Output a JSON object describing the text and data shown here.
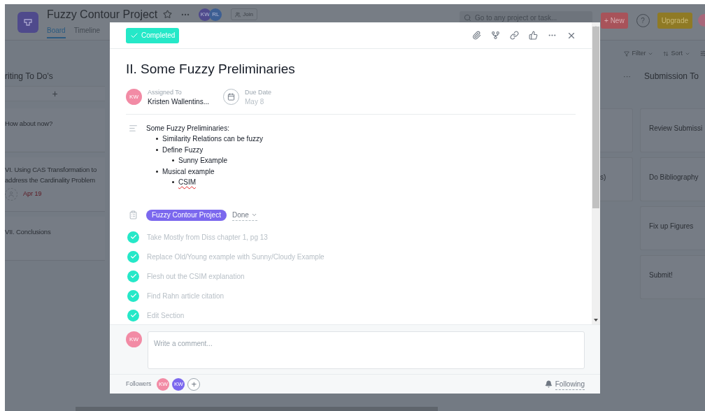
{
  "topbar": {
    "project_title": "Fuzzy Contour Project",
    "members": [
      {
        "initials": "KW",
        "color": "#4f4a8c"
      },
      {
        "initials": "RL",
        "color": "#3d5f93"
      }
    ],
    "join": "Join",
    "tabs": [
      {
        "label": "Board",
        "selected": true
      },
      {
        "label": "Timeline",
        "selected": false
      }
    ],
    "search": {
      "placeholder": "Go to any project or task..."
    },
    "new_button": "+ New",
    "help": "?",
    "upgrade": "Upgrade"
  },
  "toolbar": {
    "filter": "Filter",
    "sort": "Sort"
  },
  "left_column": {
    "title": "riting To Do's",
    "add": "+",
    "cards": [
      {
        "title": "How about now?"
      },
      {
        "title": "VI. Using CAS Transformation to address the Cardinality Problem",
        "due": "Apr 19"
      },
      {
        "title": "VII. Conclusions"
      }
    ]
  },
  "middle_column": {
    "menu": "···",
    "cards": [
      {
        "title": "s)"
      }
    ]
  },
  "right_column": {
    "title": "Submission To",
    "cards": [
      {
        "title": "Review Submissi"
      },
      {
        "title": "Do Bibliography"
      },
      {
        "title": "Fix up Figures"
      },
      {
        "title": "Submit!"
      }
    ]
  },
  "task": {
    "completed": true,
    "completed_label": "Completed",
    "title": "II. Some Fuzzy Preliminaries",
    "assignee": {
      "label": "Assigned To",
      "initials": "KW",
      "name": "Kristen Wallentins..."
    },
    "due": {
      "label": "Due Date",
      "value": "May 8"
    },
    "description": {
      "intro": "Some Fuzzy Preliminaries:",
      "bullets": [
        {
          "text": "Similarity Relations can be fuzzy",
          "misspelled": false
        },
        {
          "text": "Define Fuzzy",
          "misspelled": false,
          "children": [
            {
              "text": "Sunny Example",
              "misspelled": false
            }
          ]
        },
        {
          "text": "Musical example",
          "misspelled": false,
          "children": [
            {
              "text": "CSIM",
              "misspelled": true
            }
          ]
        }
      ]
    },
    "project": {
      "name": "Fuzzy Contour Project",
      "status": "Done"
    },
    "subtasks": [
      {
        "text": "Take Mostly from Diss chapter 1, pg 13",
        "completed": true
      },
      {
        "text": "Replace Old/Young example with Sunny/Cloudy Example",
        "completed": true
      },
      {
        "text": "Flesh out the CSIM explanation",
        "completed": true
      },
      {
        "text": "Find Rahn article citation",
        "completed": true
      },
      {
        "text": "Edit Section",
        "completed": true
      }
    ],
    "comment": {
      "initials": "KW",
      "placeholder": "Write a comment..."
    },
    "followers": {
      "label": "Followers",
      "avatars": [
        {
          "initials": "KW",
          "color": "#f28ba5"
        },
        {
          "initials": "KW",
          "color": "#7b68ee"
        }
      ],
      "add": "+"
    },
    "following": "Following"
  }
}
